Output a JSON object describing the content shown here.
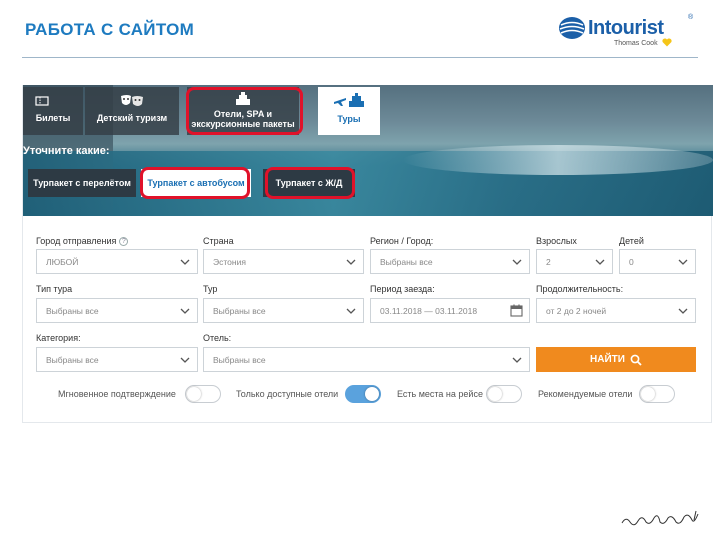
{
  "slide": {
    "title": "РАБОТА С САЙТОМ"
  },
  "brand": {
    "name": "Intourist",
    "registered": "®",
    "sub": "Thomas Cook",
    "colors": {
      "primary": "#1b5fa8",
      "heart": "#f5c518"
    }
  },
  "nav": {
    "tabs": [
      {
        "label": "Билеты",
        "icon": "ticket-icon",
        "active": false,
        "highlighted": false
      },
      {
        "label": "Детский туризм",
        "icon": "theater-masks-icon",
        "active": false,
        "highlighted": false
      },
      {
        "label_line1": "Отели, SPA и",
        "label_line2": "экскурсионные пакеты",
        "icon": "hotel-icon",
        "active": false,
        "highlighted": true
      },
      {
        "label": "Туры",
        "icon": "plane-hotel-icon",
        "active": true,
        "highlighted": false
      }
    ]
  },
  "refine": {
    "label": "Уточните какие:",
    "tabs": [
      {
        "label": "Турпакет с перелётом",
        "active": false,
        "highlighted": false
      },
      {
        "label": "Турпакет с автобусом",
        "active": true,
        "highlighted": true
      },
      {
        "label": "Турпакет с Ж/Д",
        "active": false,
        "highlighted": true
      }
    ]
  },
  "form": {
    "departure": {
      "label": "Город отправления",
      "value": "ЛЮБОЙ",
      "help": "?"
    },
    "country": {
      "label": "Страна",
      "value": "Эстония"
    },
    "region": {
      "label": "Регион / Город:",
      "value": "Выбраны все"
    },
    "adults": {
      "label": "Взрослых",
      "value": "2"
    },
    "children": {
      "label": "Детей",
      "value": "0"
    },
    "tour_type": {
      "label": "Тип тура",
      "value": "Выбраны все"
    },
    "tour": {
      "label": "Тур",
      "value": "Выбраны все"
    },
    "period": {
      "label": "Период заезда:",
      "value": "03.11.2018 — 03.11.2018"
    },
    "duration": {
      "label": "Продолжительность:",
      "value": "от 2 до 2 ночей"
    },
    "category": {
      "label": "Категория:",
      "value": "Выбраны все"
    },
    "hotel": {
      "label": "Отель:",
      "value": "Выбраны все"
    },
    "find_button": {
      "label": "НАЙТИ",
      "color": "#f08a1e"
    }
  },
  "toggles": [
    {
      "label": "Мгновенное подтверждение",
      "on": false
    },
    {
      "label": "Только доступные отели",
      "on": true
    },
    {
      "label": "Есть места на рейсе",
      "on": false
    },
    {
      "label": "Рекомендуемые отели",
      "on": false
    }
  ],
  "highlight_color": "#e0122a"
}
